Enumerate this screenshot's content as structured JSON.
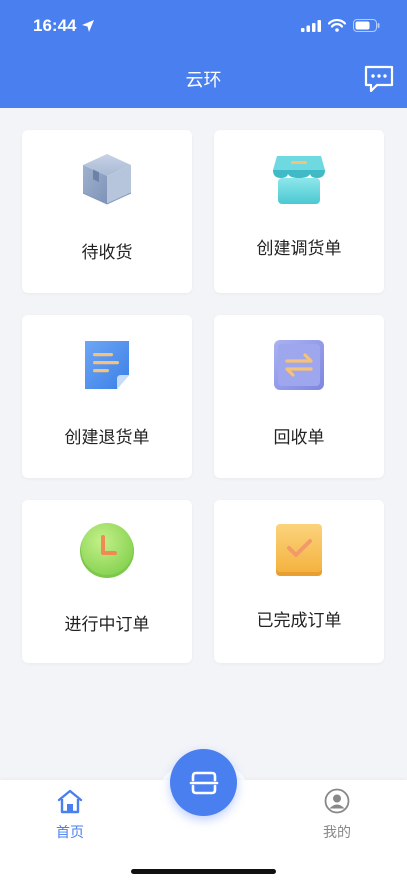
{
  "status": {
    "time": "16:44"
  },
  "header": {
    "title": "云环",
    "message_icon": "chat-bubble-icon"
  },
  "cards": [
    {
      "label": "待收货",
      "icon": "box-icon"
    },
    {
      "label": "创建调货单",
      "icon": "store-icon"
    },
    {
      "label": "创建退货单",
      "icon": "document-icon"
    },
    {
      "label": "回收单",
      "icon": "exchange-icon"
    },
    {
      "label": "进行中订单",
      "icon": "clock-icon"
    },
    {
      "label": "已完成订单",
      "icon": "check-icon"
    }
  ],
  "tabbar": {
    "home_label": "首页",
    "mine_label": "我的",
    "active_color": "#4a7ff0",
    "inactive_color": "#888888",
    "scan_icon": "scan-icon"
  }
}
